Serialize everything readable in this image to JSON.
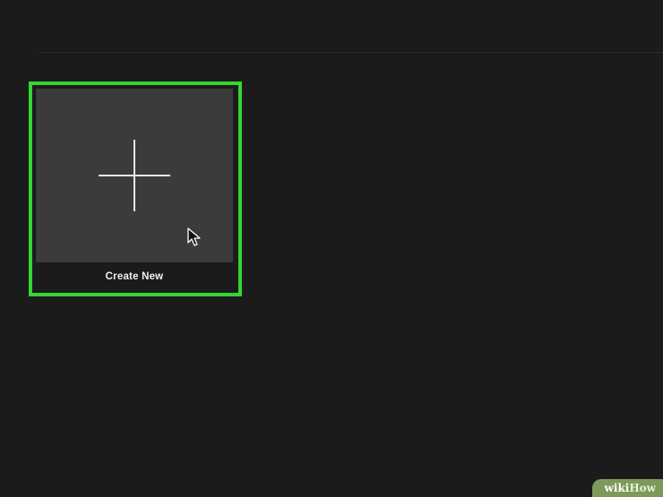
{
  "card": {
    "label": "Create New",
    "icon": "plus-icon"
  },
  "cursor": {
    "icon": "mouse-pointer-icon"
  },
  "highlight": {
    "color": "#33d633"
  },
  "watermark": {
    "prefix": "wiki",
    "suffix": "How"
  }
}
